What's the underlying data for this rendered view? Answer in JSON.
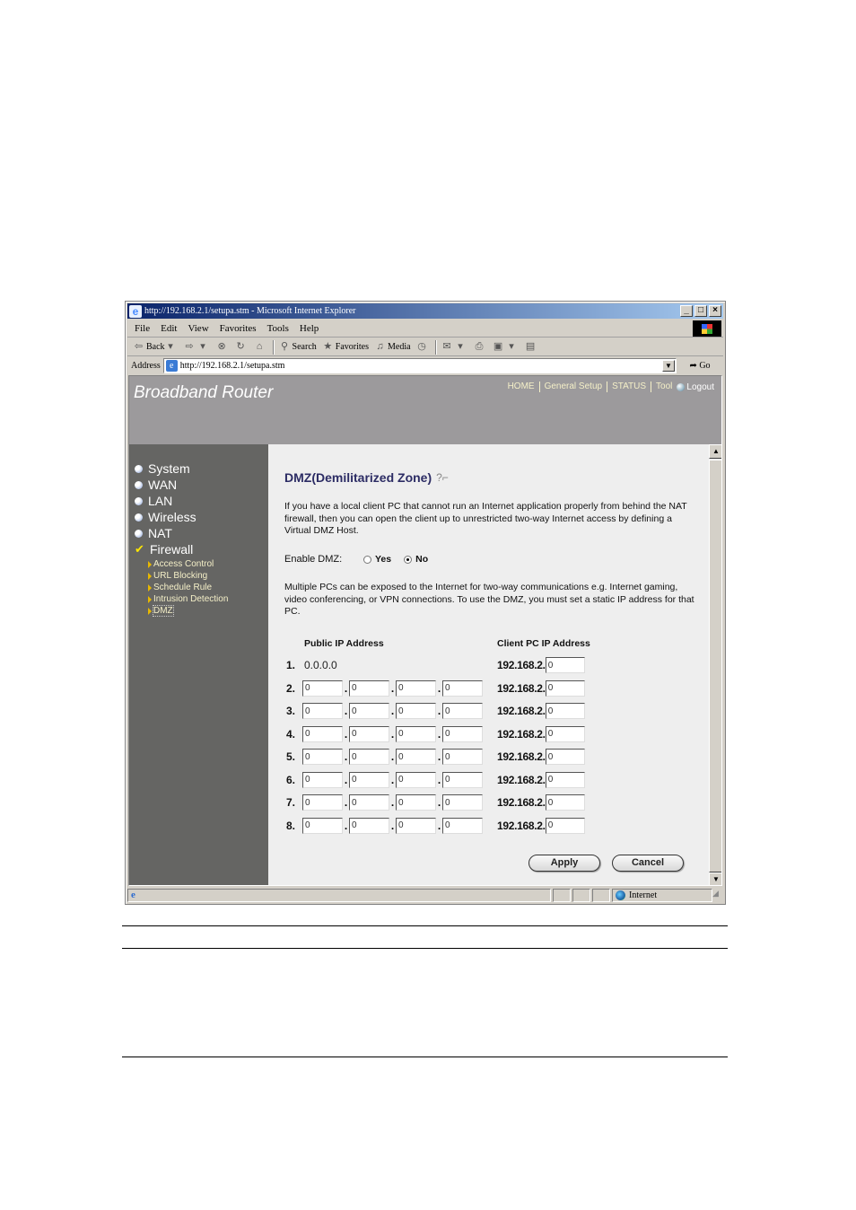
{
  "browser": {
    "window_title": "http://192.168.2.1/setupa.stm - Microsoft Internet Explorer",
    "window_buttons": [
      "_",
      "□",
      "×"
    ],
    "menu": [
      "File",
      "Edit",
      "View",
      "Favorites",
      "Tools",
      "Help"
    ],
    "toolbar": {
      "back": "Back",
      "search": "Search",
      "favorites": "Favorites",
      "media": "Media"
    },
    "address_label": "Address",
    "url": "http://192.168.2.1/setupa.stm",
    "go_label": "Go",
    "status_zone": "Internet"
  },
  "router": {
    "brand": "Broadband Router",
    "top_nav": [
      "HOME",
      "General Setup",
      "STATUS",
      "Tool"
    ],
    "logout": "Logout",
    "sidebar": {
      "items": [
        "System",
        "WAN",
        "LAN",
        "Wireless",
        "NAT",
        "Firewall"
      ],
      "active_item": "Firewall",
      "sub_items": [
        "Access Control",
        "URL Blocking",
        "Schedule Rule",
        "Intrusion Detection",
        "DMZ"
      ],
      "active_sub_item": "DMZ"
    },
    "page": {
      "title": "DMZ(Demilitarized Zone)",
      "intro": "If you have a local client PC that cannot run an Internet application properly from behind the NAT firewall, then you can open the client up to unrestricted two-way Internet access by defining a Virtual DMZ Host.",
      "enable_label": "Enable DMZ:",
      "enable_options": [
        "Yes",
        "No"
      ],
      "enable_selected": "No",
      "multi_text": "Multiple PCs can be exposed to the Internet for two-way communications e.g. Internet gaming, video conferencing, or VPN connections.  To use the DMZ, you must set a static IP address for that PC.",
      "col_public": "Public IP Address",
      "col_client": "Client PC IP Address",
      "client_prefix": "192.168.2.",
      "rows": [
        {
          "num": "1.",
          "public_static": "0.0.0.0",
          "client": "0"
        },
        {
          "num": "2.",
          "public": [
            "0",
            "0",
            "0",
            "0"
          ],
          "client": "0"
        },
        {
          "num": "3.",
          "public": [
            "0",
            "0",
            "0",
            "0"
          ],
          "client": "0"
        },
        {
          "num": "4.",
          "public": [
            "0",
            "0",
            "0",
            "0"
          ],
          "client": "0"
        },
        {
          "num": "5.",
          "public": [
            "0",
            "0",
            "0",
            "0"
          ],
          "client": "0"
        },
        {
          "num": "6.",
          "public": [
            "0",
            "0",
            "0",
            "0"
          ],
          "client": "0"
        },
        {
          "num": "7.",
          "public": [
            "0",
            "0",
            "0",
            "0"
          ],
          "client": "0"
        },
        {
          "num": "8.",
          "public": [
            "0",
            "0",
            "0",
            "0"
          ],
          "client": "0"
        }
      ],
      "apply_label": "Apply",
      "cancel_label": "Cancel"
    }
  }
}
